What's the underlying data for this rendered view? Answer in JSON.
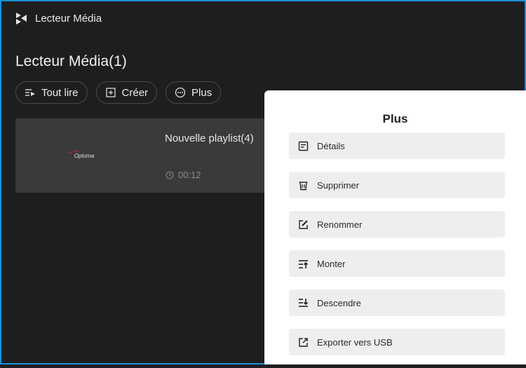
{
  "app": {
    "title": "Lecteur Média"
  },
  "page": {
    "title": "Lecteur Média(1)"
  },
  "toolbar": {
    "play_all": "Tout lire",
    "create": "Créer",
    "more": "Plus"
  },
  "playlist": {
    "brand": "Optoma",
    "name": "Nouvelle playlist(4)",
    "duration": "00:12"
  },
  "more_panel": {
    "title": "Plus",
    "items": [
      {
        "label": "Détails",
        "icon": "details-icon"
      },
      {
        "label": "Supprimer",
        "icon": "trash-icon"
      },
      {
        "label": "Renommer",
        "icon": "rename-icon"
      },
      {
        "label": "Monter",
        "icon": "move-up-icon"
      },
      {
        "label": "Descendre",
        "icon": "move-down-icon"
      },
      {
        "label": "Exporter vers USB",
        "icon": "export-icon"
      }
    ]
  },
  "colors": {
    "background": "#1e1e1f",
    "accent": "#1a8fd6",
    "panel": "#ffffff"
  }
}
